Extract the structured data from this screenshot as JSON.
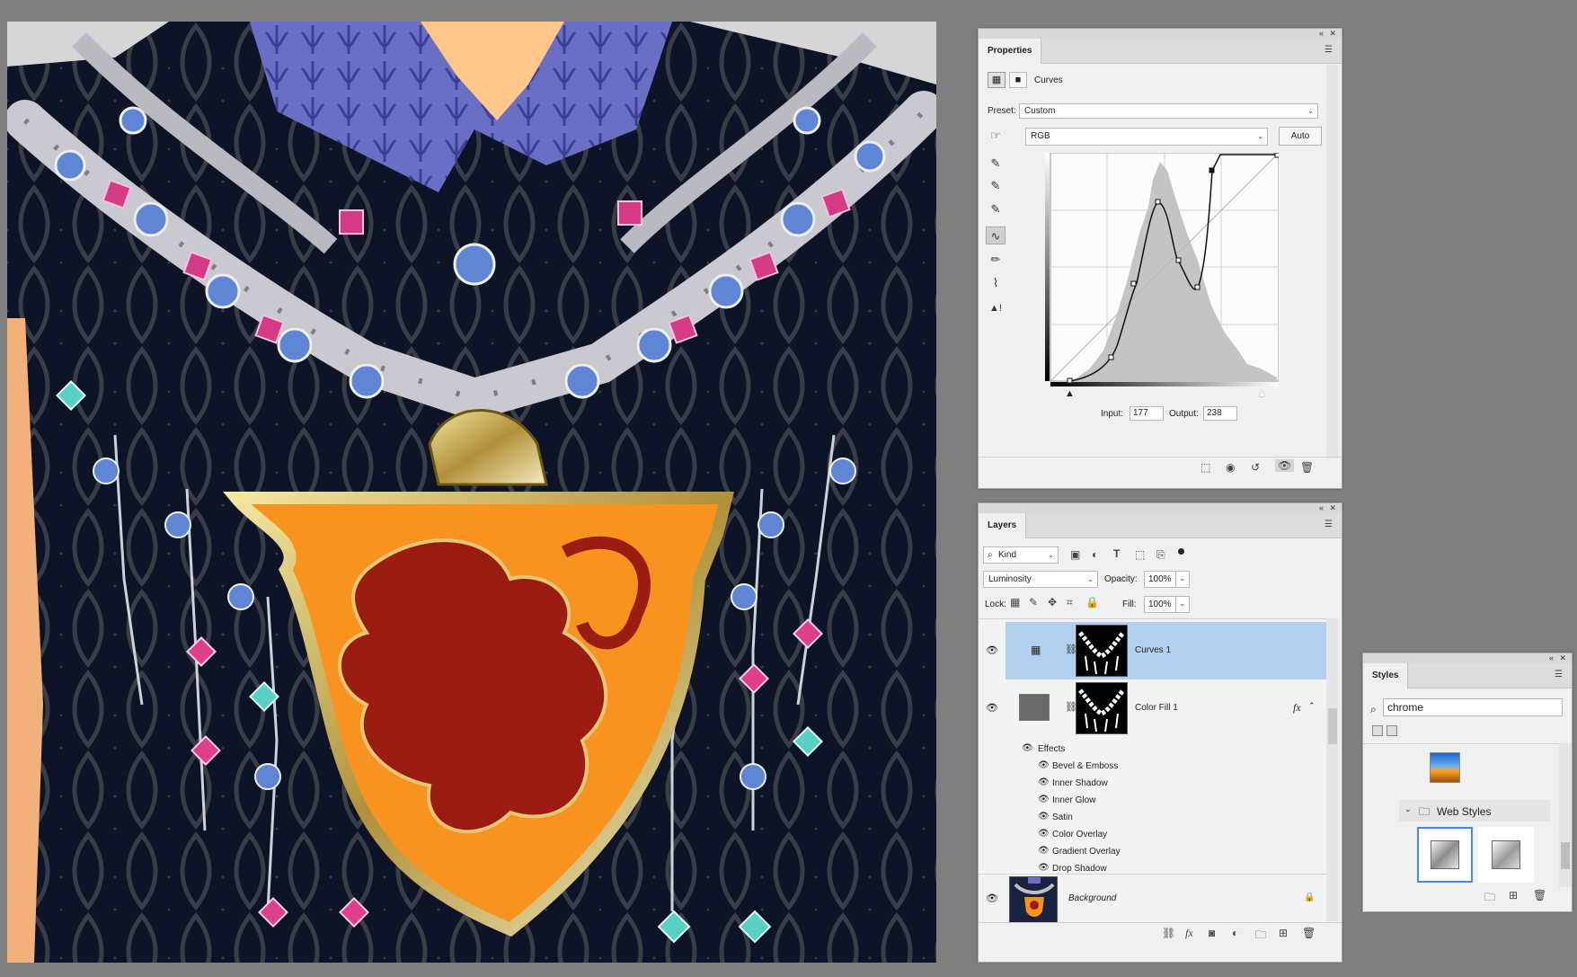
{
  "properties": {
    "tab": "Properties",
    "adjustment_name": "Curves",
    "preset_label": "Preset:",
    "preset_value": "Custom",
    "channel": "RGB",
    "auto_label": "Auto",
    "input_label": "Input:",
    "input_value": "177",
    "output_label": "Output:",
    "output_value": "238"
  },
  "layers": {
    "tab": "Layers",
    "filter_kind": "Kind",
    "blend_mode": "Luminosity",
    "opacity_label": "Opacity:",
    "opacity_value": "100%",
    "lock_label": "Lock:",
    "fill_label": "Fill:",
    "fill_value": "100%",
    "items": [
      {
        "name": "Curves 1",
        "selected": true
      },
      {
        "name": "Color Fill 1",
        "fx": "fx"
      },
      {
        "name": "Background"
      }
    ],
    "effects_label": "Effects",
    "effects": [
      "Bevel & Emboss",
      "Inner Shadow",
      "Inner Glow",
      "Satin",
      "Color Overlay",
      "Gradient Overlay",
      "Drop Shadow"
    ]
  },
  "styles": {
    "tab": "Styles",
    "search_value": "chrome",
    "group_name": "Web Styles"
  },
  "colors": {
    "shield": "#f7931e",
    "lion": "#9b1c10",
    "fabric": "#0d1427",
    "collar": "#6a6fc4",
    "selection": "#b3d1ee"
  },
  "icons": [
    "close-icon",
    "collapse-icon",
    "panel-menu-icon",
    "eye-icon",
    "link-icon",
    "lock-icon",
    "trash-icon",
    "folder-icon",
    "new-layer-icon",
    "fx-icon",
    "search-icon"
  ]
}
